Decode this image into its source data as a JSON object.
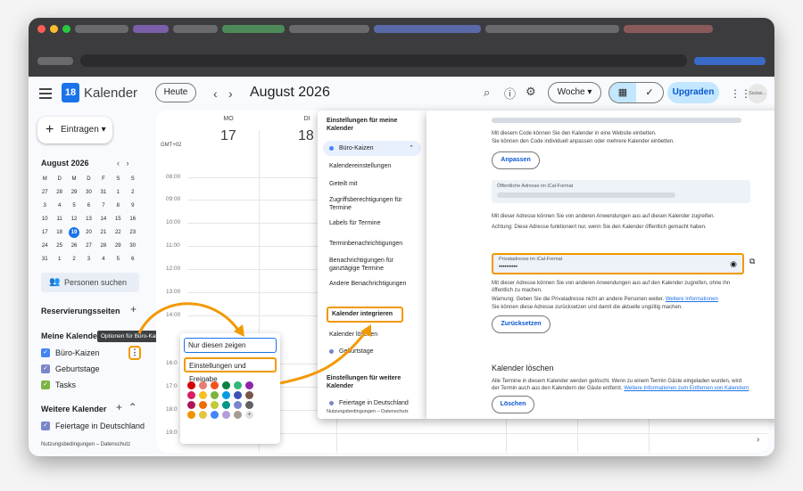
{
  "app": {
    "title": "Kalender",
    "logo_day": "18"
  },
  "header": {
    "today_button": "Heute",
    "prev_icon": "‹",
    "next_icon": "›",
    "current_period": "August 2026",
    "view_select": "Woche ▾",
    "upgrade_button": "Upgraden",
    "avatar_text": "Sozias...",
    "icons": [
      "search-icon",
      "help-icon",
      "settings-icon",
      "calendar-view-icon",
      "tasks-view-icon",
      "apps-grid-icon"
    ]
  },
  "sidebar": {
    "create_button": "Eintragen ▾",
    "mini_month": "August 2026",
    "weekdays": [
      "M",
      "D",
      "M",
      "D",
      "F",
      "S",
      "S"
    ],
    "weeks": [
      [
        "27",
        "28",
        "29",
        "30",
        "31",
        "1",
        "2"
      ],
      [
        "3",
        "4",
        "5",
        "6",
        "7",
        "8",
        "9"
      ],
      [
        "10",
        "11",
        "12",
        "13",
        "14",
        "15",
        "16"
      ],
      [
        "17",
        "18",
        "19",
        "20",
        "21",
        "22",
        "23"
      ],
      [
        "24",
        "25",
        "26",
        "27",
        "28",
        "29",
        "30"
      ],
      [
        "31",
        "1",
        "2",
        "3",
        "4",
        "5",
        "6"
      ]
    ],
    "today": "19",
    "people_search": "Personen suchen",
    "booking_pages": "Reservierungsseiten",
    "my_calendars": "Meine Kalender",
    "my_calendar_items": [
      "Büro-Kaizen",
      "Geburtstage",
      "Tasks"
    ],
    "other_calendars": "Weitere Kalender",
    "other_calendar_items": [
      "Feiertage in Deutschland"
    ],
    "footer": "Nutzungsbedingungen – Datenschutz",
    "tooltip": "Optionen für Büro-Kaizen",
    "colors": {
      "buero": "#4285f4",
      "geburtstage": "#7986cb",
      "tasks": "#7cb342",
      "feiertage": "#7986cb"
    }
  },
  "week": {
    "timezone": "GMT+02",
    "days": [
      {
        "label": "MO",
        "num": "17"
      },
      {
        "label": "DI",
        "num": "18"
      }
    ],
    "hours": [
      "08:00",
      "09:00",
      "10:00",
      "11:00",
      "12:00",
      "13:00",
      "14:00",
      "16:0",
      "17:0",
      "18:0",
      "19:0"
    ]
  },
  "context_menu": {
    "items": [
      "Nur diesen zeigen",
      "Einstellungen und Freigabe"
    ],
    "palette": [
      "#d50000",
      "#e67c73",
      "#f4511e",
      "#0b8043",
      "#33b679",
      "#8e24aa",
      "#d81b60",
      "#f6bf26",
      "#7cb342",
      "#039be5",
      "#3f51b5",
      "#795548",
      "#ad1457",
      "#ef6c00",
      "#c0ca33",
      "#009688",
      "#7986cb",
      "#616161",
      "#f09300",
      "#e4c441",
      "#4285f4",
      "#b39ddb",
      "#a79b8e"
    ],
    "add_color": "+"
  },
  "settings_nav": {
    "heading_my": "Einstellungen für meine Kalender",
    "selected_calendar": "Büro-Kaizen",
    "items": [
      "Kalendereinstellungen",
      "Geteilt mit",
      "Zugriffsberechtigungen für Termine",
      "Labels für Termine",
      "Terminbenachrichtigungen",
      "Benachrichtigungen für ganztägige Termine",
      "Andere Benachrichtigungen",
      "Kalender integrieren",
      "Kalender löschen"
    ],
    "other_calendar": "Geburtstage",
    "heading_other": "Einstellungen für weitere Kalender",
    "other_item": "Feiertage in Deutschland",
    "footer": "Nutzungsbedingungen – Datenschutz"
  },
  "settings_main": {
    "embed_text_1": "Mit diesem Code können Sie den Kalender in eine Website einbetten.",
    "embed_text_2": "Sie können den Code individuell anpassen oder mehrere Kalender einbetten.",
    "customize_button": "Anpassen",
    "public_ical_label": "Öffentliche Adresse im iCal-Format",
    "public_text_1": "Mit dieser Adresse können Sie von anderen Anwendungen aus auf diesen Kalender zugreifen.",
    "public_text_2": "Achtung: Diese Adresse funktioniert nur, wenn Sie den Kalender öffentlich gemacht haben.",
    "private_ical_label": "Privatadresse im iCal-Format",
    "private_value": "••••••••••",
    "private_text_1": "Mit dieser Adresse können Sie von anderen Anwendungen aus auf den Kalender zugreifen, ohne ihn öffentlich zu machen.",
    "private_warning": "Warnung: Geben Sie die Privatadresse nicht an andere Personen weiter.",
    "more_info": "Weitere Informationen",
    "private_text_2": "Sie können diese Adresse zurücksetzen und damit die aktuelle ungültig machen.",
    "reset_button": "Zurücksetzen",
    "delete_heading": "Kalender löschen",
    "delete_text": "Alle Termine in diesem Kalender werden gelöscht. Wenn zu einem Termin Gäste eingeladen wurden, wird der Termin auch aus den Kalendern der Gäste entfernt.",
    "delete_link": "Weitere Informationen zum Entfernen von Kalendern",
    "delete_button": "Löschen"
  },
  "accent": {
    "highlight": "#f29900",
    "primary": "#1a73e8"
  }
}
